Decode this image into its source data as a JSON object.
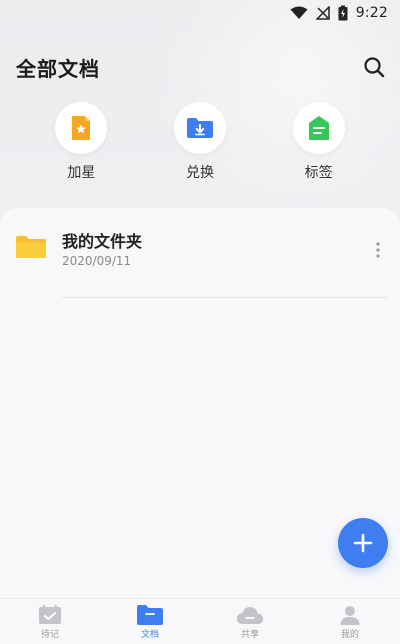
{
  "status_bar": {
    "time": "9:22"
  },
  "header": {
    "title": "全部文档"
  },
  "quick_actions": [
    {
      "label": "加星",
      "icon": "star-doc-icon",
      "color": "#f5a623"
    },
    {
      "label": "兑换",
      "icon": "folder-download-icon",
      "color": "#3f7ef0"
    },
    {
      "label": "标签",
      "icon": "tag-icon",
      "color": "#34c759"
    }
  ],
  "list": [
    {
      "title": "我的文件夹",
      "date": "2020/09/11",
      "icon": "folder-icon",
      "color": "#f7c02f"
    }
  ],
  "fab": {
    "icon": "plus-icon",
    "color": "#3f7ef0"
  },
  "bottom_nav": [
    {
      "label": "待记",
      "icon": "notebook-icon",
      "active": false
    },
    {
      "label": "文档",
      "icon": "folder-icon",
      "active": true
    },
    {
      "label": "共享",
      "icon": "cloud-icon",
      "active": false
    },
    {
      "label": "我的",
      "icon": "user-icon",
      "active": false
    }
  ]
}
